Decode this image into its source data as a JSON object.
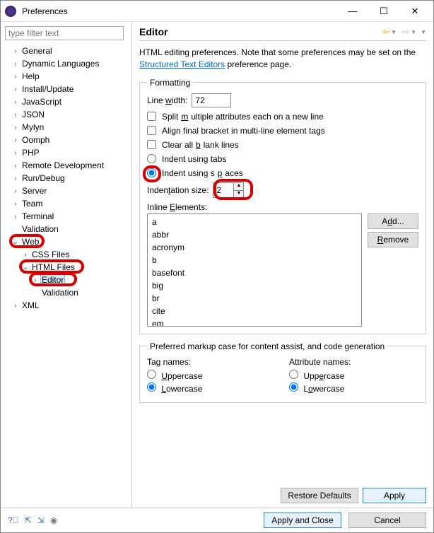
{
  "window": {
    "title": "Preferences"
  },
  "filter": {
    "placeholder": "type filter text"
  },
  "tree": [
    {
      "d": 0,
      "tw": ">",
      "lbl": "General"
    },
    {
      "d": 0,
      "tw": ">",
      "lbl": "Dynamic Languages"
    },
    {
      "d": 0,
      "tw": ">",
      "lbl": "Help"
    },
    {
      "d": 0,
      "tw": ">",
      "lbl": "Install/Update"
    },
    {
      "d": 0,
      "tw": ">",
      "lbl": "JavaScript"
    },
    {
      "d": 0,
      "tw": ">",
      "lbl": "JSON"
    },
    {
      "d": 0,
      "tw": ">",
      "lbl": "Mylyn"
    },
    {
      "d": 0,
      "tw": ">",
      "lbl": "Oomph"
    },
    {
      "d": 0,
      "tw": ">",
      "lbl": "PHP"
    },
    {
      "d": 0,
      "tw": ">",
      "lbl": "Remote Development"
    },
    {
      "d": 0,
      "tw": ">",
      "lbl": "Run/Debug"
    },
    {
      "d": 0,
      "tw": ">",
      "lbl": "Server"
    },
    {
      "d": 0,
      "tw": ">",
      "lbl": "Team"
    },
    {
      "d": 0,
      "tw": ">",
      "lbl": "Terminal"
    },
    {
      "d": 0,
      "tw": "",
      "lbl": "Validation"
    },
    {
      "d": 0,
      "tw": "v",
      "lbl": "Web",
      "mark": true
    },
    {
      "d": 1,
      "tw": ">",
      "lbl": "CSS Files"
    },
    {
      "d": 1,
      "tw": "v",
      "lbl": "HTML Files",
      "mark": true
    },
    {
      "d": 2,
      "tw": ">",
      "lbl": "Editor",
      "sel": true,
      "mark": true
    },
    {
      "d": 2,
      "tw": "",
      "lbl": "Validation"
    },
    {
      "d": 0,
      "tw": ">",
      "lbl": "XML"
    }
  ],
  "header": {
    "title": "Editor"
  },
  "desc": {
    "pre": "HTML editing preferences.  Note that some preferences may be set on the ",
    "link": "Structured Text Editors",
    "post": " preference page."
  },
  "formatting": {
    "legend": "Formatting",
    "line_width_label": "Line width:",
    "line_width_value": "72",
    "split_label": "Split multiple attributes each on a new line",
    "split_checked": false,
    "align_label": "Align final bracket in multi-line element tags",
    "align_checked": false,
    "clear_label": "Clear all blank lines",
    "clear_checked": false,
    "indent_tabs_label": "Indent using tabs",
    "indent_spaces_label": "Indent using spaces",
    "indent_mode": "spaces",
    "indent_size_label": "Indentation size:",
    "indent_size_value": "2",
    "inline_label": "Inline Elements:",
    "inline_elements": [
      "a",
      "abbr",
      "acronym",
      "b",
      "basefont",
      "big",
      "br",
      "cite",
      "em"
    ],
    "add_label": "Add...",
    "remove_label": "Remove"
  },
  "case": {
    "legend": "Preferred markup case for content assist, and code generation",
    "tag_header": "Tag names:",
    "attr_header": "Attribute names:",
    "upper": "Uppercase",
    "lower": "Lowercase",
    "tag_sel": "lower",
    "attr_sel": "lower"
  },
  "buttons": {
    "restore": "Restore Defaults",
    "apply": "Apply",
    "apply_close": "Apply and Close",
    "cancel": "Cancel"
  }
}
